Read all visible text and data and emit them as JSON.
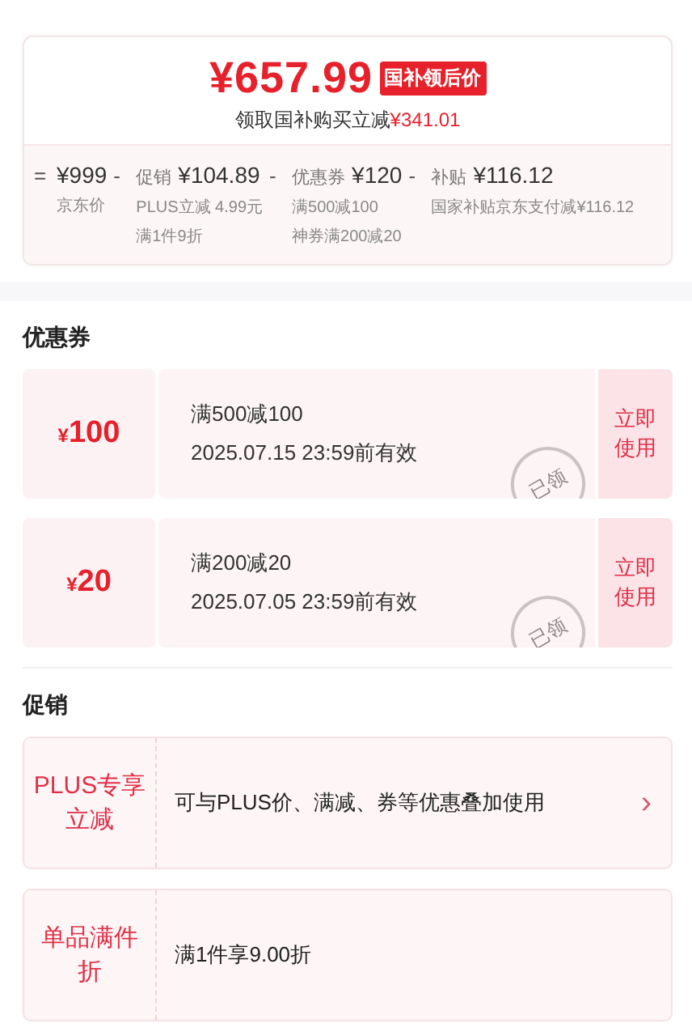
{
  "price_card": {
    "price": "¥657.99",
    "badge": "国补领后价",
    "subtitle": "领取国补购买立减",
    "subtitle_amount": "¥341.01",
    "breakdown": [
      {
        "operator": "=",
        "value": "¥999",
        "notes": [
          "京东价"
        ]
      },
      {
        "operator": "-",
        "label": "促销",
        "value": "¥104.89",
        "notes": [
          "PLUS立减 4.99元",
          "满1件9折"
        ]
      },
      {
        "operator": "-",
        "label": "优惠券",
        "value": "¥120",
        "notes": [
          "满500减100",
          "神券满200减20"
        ]
      },
      {
        "operator": "-",
        "label": "补贴",
        "value": "¥116.12",
        "notes": [
          "国家补贴京东支付减¥116.12"
        ]
      }
    ]
  },
  "coupons": {
    "title": "优惠券",
    "items": [
      {
        "currency": "¥",
        "amount": "100",
        "condition": "满500减100",
        "validity": "2025.07.15 23:59前有效",
        "claimed": true,
        "stamp": "已领",
        "action": "立即使用"
      },
      {
        "currency": "¥",
        "amount": "20",
        "condition": "满200减20",
        "validity": "2025.07.05 23:59前有效",
        "claimed": true,
        "stamp": "已领",
        "action": "立即使用"
      }
    ]
  },
  "promotions": {
    "title": "促销",
    "items": [
      {
        "tag": "PLUS专享立减",
        "description": "可与PLUS价、满减、券等优惠叠加使用",
        "arrow": "›"
      },
      {
        "tag": "单品满件折",
        "description": "满1件享9.00折"
      }
    ]
  }
}
